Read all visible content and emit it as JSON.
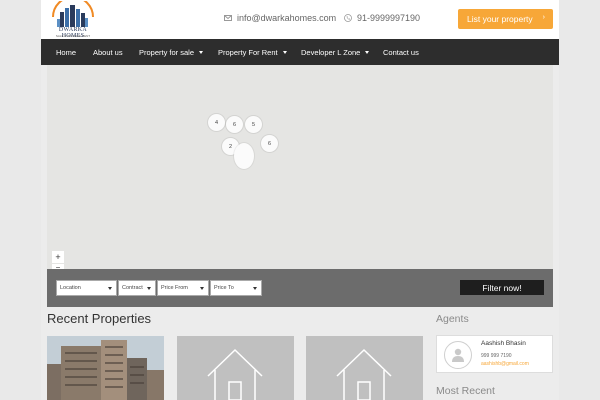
{
  "header": {
    "logo_title": "DWARKA HOMES",
    "logo_subtitle": "SALE  PURCHASE  RENT",
    "email": "info@dwarkahomes.com",
    "phone": "91-9999997190",
    "list_button": "List your property"
  },
  "nav": {
    "items": [
      {
        "label": "Home",
        "dropdown": false
      },
      {
        "label": "About us",
        "dropdown": false
      },
      {
        "label": "Property for sale",
        "dropdown": true
      },
      {
        "label": "Property For Rent",
        "dropdown": true
      },
      {
        "label": "Developer L Zone",
        "dropdown": true
      },
      {
        "label": "Contact us",
        "dropdown": false
      }
    ]
  },
  "map": {
    "clusters": [
      "4",
      "6",
      "5",
      "2",
      "6"
    ],
    "zoom_in": "+",
    "zoom_out": "−"
  },
  "filter": {
    "location": "Location",
    "contract": "Contract",
    "price_from": "Price From",
    "price_to": "Price To",
    "button": "Filter now!"
  },
  "recent": {
    "title": "Recent Properties"
  },
  "sidebar": {
    "agents_title": "Agents",
    "agent": {
      "name": "Aashish Bhasin",
      "phone": "999 999 7190",
      "email": "aashishb@gmail.com"
    },
    "most_recent_title": "Most Recent"
  },
  "colors": {
    "accent": "#f7a738",
    "nav_bg": "#2d2d2d",
    "filter_bg": "#6c6c6c"
  }
}
